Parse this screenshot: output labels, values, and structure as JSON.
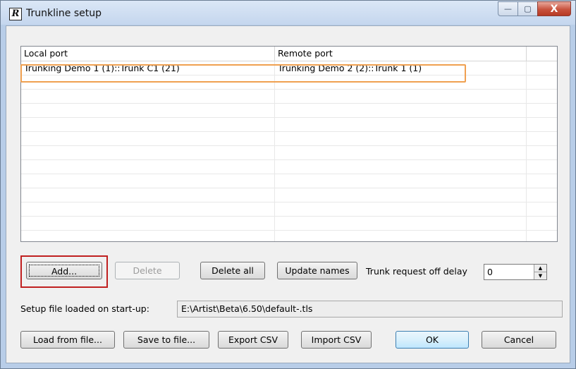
{
  "window": {
    "title": "Trunkline setup",
    "logo_letter": "R",
    "controls": {
      "minimize_glyph": "—",
      "maximize_glyph": "▢",
      "close_glyph": "X"
    }
  },
  "table": {
    "columns": [
      "Local port",
      "Remote port",
      ""
    ],
    "rows": [
      [
        "Trunking Demo 1 (1)::Trunk C1 (21)",
        "Trunking Demo 2 (2)::Trunk 1 (1)",
        ""
      ],
      [
        "",
        "",
        ""
      ],
      [
        "",
        "",
        ""
      ],
      [
        "",
        "",
        ""
      ],
      [
        "",
        "",
        ""
      ],
      [
        "",
        "",
        ""
      ],
      [
        "",
        "",
        ""
      ],
      [
        "",
        "",
        ""
      ],
      [
        "",
        "",
        ""
      ],
      [
        "",
        "",
        ""
      ],
      [
        "",
        "",
        ""
      ],
      [
        "",
        "",
        ""
      ],
      [
        "",
        "",
        ""
      ]
    ]
  },
  "actions": {
    "add": "Add...",
    "delete": "Delete",
    "delete_all": "Delete all",
    "update_names": "Update names",
    "trunk_delay_label": "Trunk request off delay",
    "trunk_delay_value": "0"
  },
  "setup": {
    "label": "Setup file loaded on start-up:",
    "path": "E:\\Artist\\Beta\\6.50\\default-.tls"
  },
  "footer": {
    "load": "Load from file...",
    "save": "Save to file...",
    "export": "Export CSV",
    "import": "Import CSV",
    "ok": "OK",
    "cancel": "Cancel"
  },
  "colors": {
    "row_highlight": "#f0a050",
    "add_highlight": "#c02020",
    "default_button": "#3c7fb1"
  }
}
